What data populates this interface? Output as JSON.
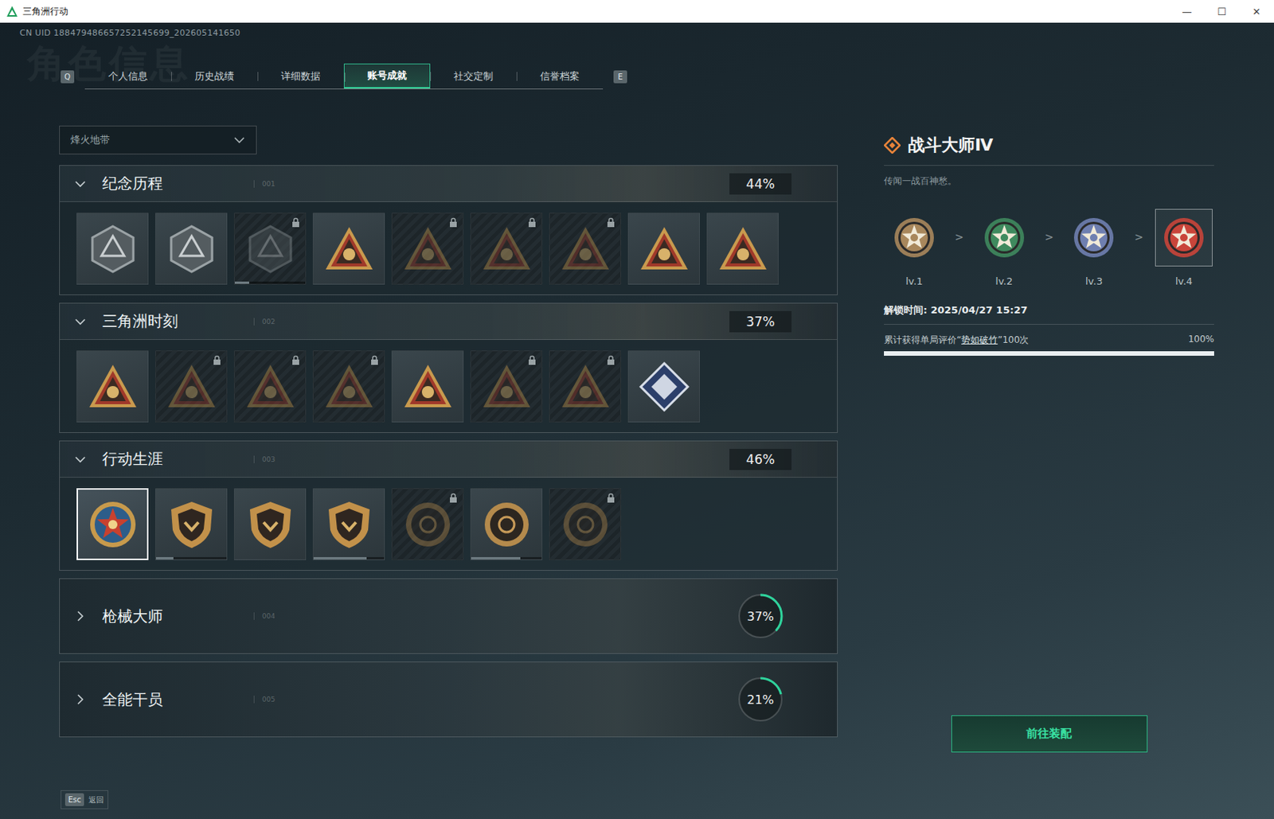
{
  "window": {
    "title": "三角洲行动",
    "controls": [
      "—",
      "☐",
      "✕"
    ]
  },
  "watermark": "角色信息",
  "uid": "CN UID 188479486657252145699_202605141650",
  "tabs": {
    "prev_key": "Q",
    "next_key": "E",
    "items": [
      {
        "label": "个人信息",
        "selected": false
      },
      {
        "label": "历史战绩",
        "selected": false
      },
      {
        "label": "详细数据",
        "selected": false
      },
      {
        "label": "账号成就",
        "selected": true
      },
      {
        "label": "社交定制",
        "selected": false
      },
      {
        "label": "信誉档案",
        "selected": false
      }
    ]
  },
  "mode_select": {
    "value": "烽火地带"
  },
  "sections": [
    {
      "title": "纪念历程",
      "index": "001",
      "percent": "44%",
      "expanded": true,
      "badges": [
        {
          "kind": "hex",
          "locked": false,
          "selected": false
        },
        {
          "kind": "hex",
          "locked": false,
          "selected": false
        },
        {
          "kind": "hex",
          "locked": true,
          "selected": false,
          "level": 0.2
        },
        {
          "kind": "triangle",
          "locked": false,
          "selected": false
        },
        {
          "kind": "triangle",
          "locked": true,
          "selected": false
        },
        {
          "kind": "triangle",
          "locked": true,
          "selected": false
        },
        {
          "kind": "triangle",
          "locked": true,
          "selected": false
        },
        {
          "kind": "triangle",
          "locked": false,
          "selected": false
        },
        {
          "kind": "triangle",
          "locked": false,
          "selected": false
        }
      ]
    },
    {
      "title": "三角洲时刻",
      "index": "002",
      "percent": "37%",
      "expanded": true,
      "badges": [
        {
          "kind": "triangle",
          "locked": false,
          "selected": false
        },
        {
          "kind": "triangle",
          "locked": true,
          "selected": false
        },
        {
          "kind": "triangle",
          "locked": true,
          "selected": false
        },
        {
          "kind": "triangle",
          "locked": true,
          "selected": false
        },
        {
          "kind": "triangle",
          "locked": false,
          "selected": false
        },
        {
          "kind": "triangle",
          "locked": true,
          "selected": false
        },
        {
          "kind": "triangle",
          "locked": true,
          "selected": false
        },
        {
          "kind": "diamond",
          "locked": false,
          "selected": false
        }
      ]
    },
    {
      "title": "行动生涯",
      "index": "003",
      "percent": "46%",
      "expanded": true,
      "badges": [
        {
          "kind": "star",
          "locked": false,
          "selected": true
        },
        {
          "kind": "shield",
          "locked": false,
          "selected": false,
          "level": 0.25
        },
        {
          "kind": "shield",
          "locked": false,
          "selected": false
        },
        {
          "kind": "shield",
          "locked": false,
          "selected": false,
          "level": 0.75
        },
        {
          "kind": "round",
          "locked": true,
          "selected": false
        },
        {
          "kind": "round",
          "locked": false,
          "selected": false,
          "level": 0.7
        },
        {
          "kind": "round",
          "locked": true,
          "selected": false
        }
      ]
    },
    {
      "title": "枪械大师",
      "index": "004",
      "percent": "37%",
      "expanded": false,
      "level": 0.37
    },
    {
      "title": "全能干员",
      "index": "005",
      "percent": "21%",
      "expanded": false,
      "level": 0.21
    }
  ],
  "detail": {
    "title": "战斗大师Ⅳ",
    "description": "传闻一战百神愁。",
    "levels": [
      {
        "label": "lv.1",
        "color": "#a8875c",
        "selected": false
      },
      {
        "label": "lv.2",
        "color": "#3f8a5e",
        "selected": false
      },
      {
        "label": "lv.3",
        "color": "#6f7fb0",
        "selected": false
      },
      {
        "label": "lv.4",
        "color": "#c9453a",
        "selected": true
      }
    ],
    "separator": ">",
    "unlock": "解锁时间: 2025/04/27 15:27",
    "requirement": {
      "prefix": "累计获得单局评价“",
      "link": "势如破竹",
      "suffix": "”100次",
      "percent": "100%",
      "level": 1
    },
    "button": "前往装配"
  },
  "footer": {
    "key": "Esc",
    "label": "返回"
  }
}
